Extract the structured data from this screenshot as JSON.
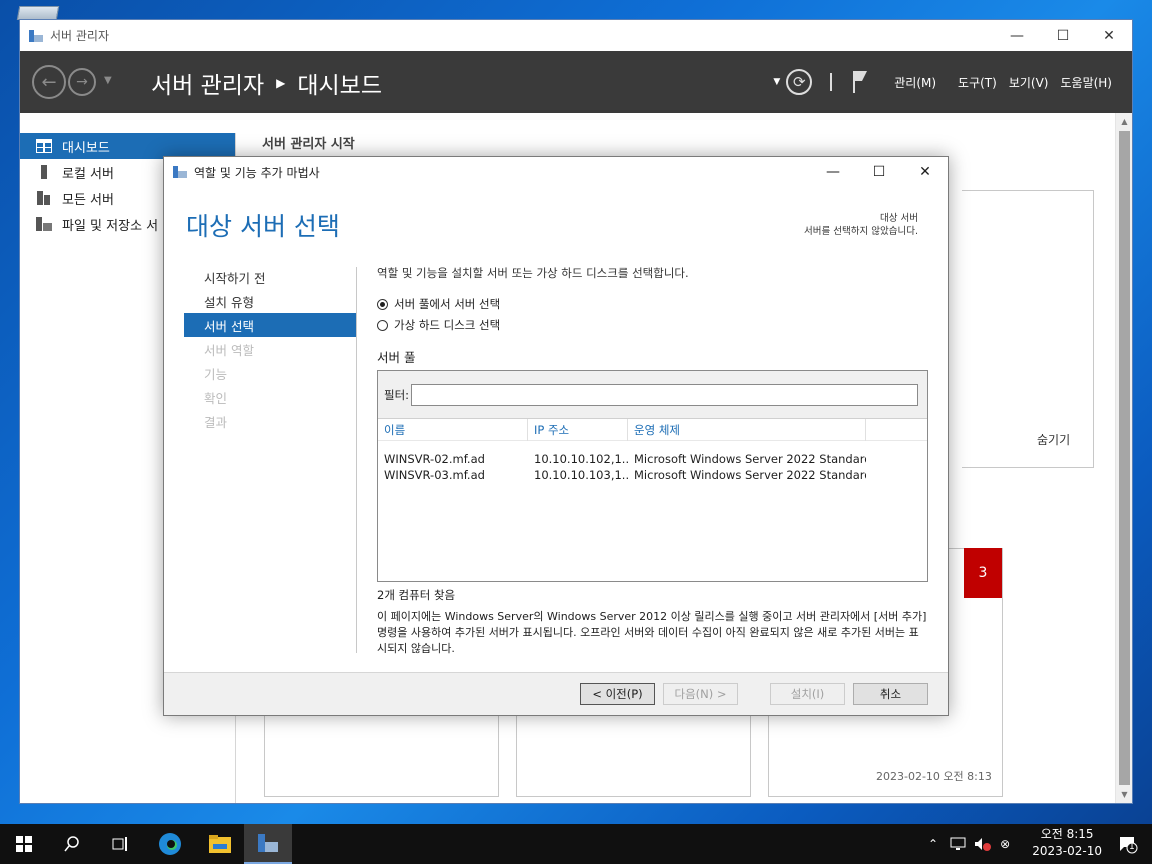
{
  "server_manager": {
    "window_title": "서버 관리자",
    "breadcrumb_app": "서버 관리자",
    "breadcrumb_page": "대시보드",
    "menu": [
      "관리(M)",
      "도구(T)",
      "보기(V)",
      "도움말(H)"
    ],
    "sidebar": [
      {
        "label": "대시보드",
        "icon": "dashboard-icon",
        "active": true
      },
      {
        "label": "로컬 서버",
        "icon": "server-icon",
        "active": false
      },
      {
        "label": "모든 서버",
        "icon": "servers-icon",
        "active": false
      },
      {
        "label": "파일 및 저장소 서",
        "icon": "storage-icon",
        "active": false
      }
    ],
    "section_title": "서버 관리자 시작",
    "hide_label": "숨기기",
    "tile_count": "3",
    "tile_timestamp": "2023-02-10 오전 8:13"
  },
  "wizard": {
    "title": "역할 및 기능 추가 마법사",
    "heading": "대상 서버 선택",
    "destination_label": "대상 서버",
    "destination_value": "서버를 선택하지 않았습니다.",
    "steps": [
      {
        "label": "시작하기 전",
        "state": "normal"
      },
      {
        "label": "설치 유형",
        "state": "normal"
      },
      {
        "label": "서버 선택",
        "state": "active"
      },
      {
        "label": "서버 역할",
        "state": "disabled"
      },
      {
        "label": "기능",
        "state": "disabled"
      },
      {
        "label": "확인",
        "state": "disabled"
      },
      {
        "label": "결과",
        "state": "disabled"
      }
    ],
    "description": "역할 및 기능을 설치할 서버 또는 가상 하드 디스크를 선택합니다.",
    "radio_pool": "서버 풀에서 서버 선택",
    "radio_vhd": "가상 하드 디스크 선택",
    "pool_label": "서버 풀",
    "filter_label": "필터:",
    "filter_value": "",
    "columns": [
      "이름",
      "IP 주소",
      "운영 체제"
    ],
    "rows": [
      {
        "name": "WINSVR-02.mf.ad",
        "ip": "10.10.10.102,1...",
        "os": "Microsoft Windows Server 2022 Standard"
      },
      {
        "name": "WINSVR-03.mf.ad",
        "ip": "10.10.10.103,1...",
        "os": "Microsoft Windows Server 2022 Standard"
      }
    ],
    "found_text": "2개 컴퓨터 찾음",
    "note_text": "이 페이지에는 Windows Server의 Windows Server 2012 이상 릴리스를 실행 중이고 서버 관리자에서 [서버 추가] 명령을 사용하여 추가된 서버가 표시됩니다. 오프라인 서버와 데이터 수집이 아직 완료되지 않은 새로 추가된 서버는 표시되지 않습니다.",
    "buttons": {
      "prev": "< 이전(P)",
      "next": "다음(N) >",
      "install": "설치(I)",
      "cancel": "취소"
    }
  },
  "taskbar": {
    "time": "오전 8:15",
    "date": "2023-02-10",
    "notification_count": "1"
  }
}
